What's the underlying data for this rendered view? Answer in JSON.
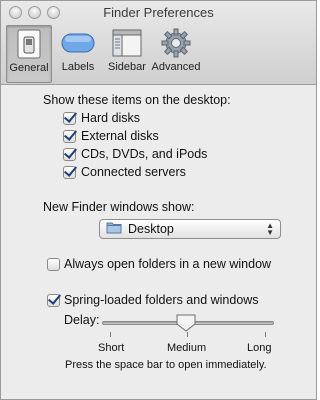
{
  "window": {
    "title": "Finder Preferences"
  },
  "toolbar": {
    "items": [
      {
        "label": "General",
        "icon": "switch-icon",
        "selected": true
      },
      {
        "label": "Labels",
        "icon": "label-tag-icon",
        "selected": false
      },
      {
        "label": "Sidebar",
        "icon": "sidebar-window-icon",
        "selected": false
      },
      {
        "label": "Advanced",
        "icon": "gear-icon",
        "selected": false
      }
    ]
  },
  "desktop": {
    "heading": "Show these items on the desktop:",
    "items": [
      {
        "label": "Hard disks",
        "checked": true
      },
      {
        "label": "External disks",
        "checked": true
      },
      {
        "label": "CDs, DVDs, and iPods",
        "checked": true
      },
      {
        "label": "Connected servers",
        "checked": true
      }
    ]
  },
  "new_window": {
    "heading": "New Finder windows show:",
    "selected": "Desktop"
  },
  "always_open": {
    "label": "Always open folders in a new window",
    "checked": false
  },
  "spring_loaded": {
    "label": "Spring-loaded folders and windows",
    "checked": true,
    "delay_label": "Delay:",
    "delay_value": 0.5,
    "ticks": [
      "Short",
      "Medium",
      "Long"
    ],
    "note": "Press the space bar to open immediately."
  },
  "colors": {
    "window_bg": "#ececec",
    "checkmark": "#1d3f7a",
    "labels_blue": "#6fa8e6"
  }
}
